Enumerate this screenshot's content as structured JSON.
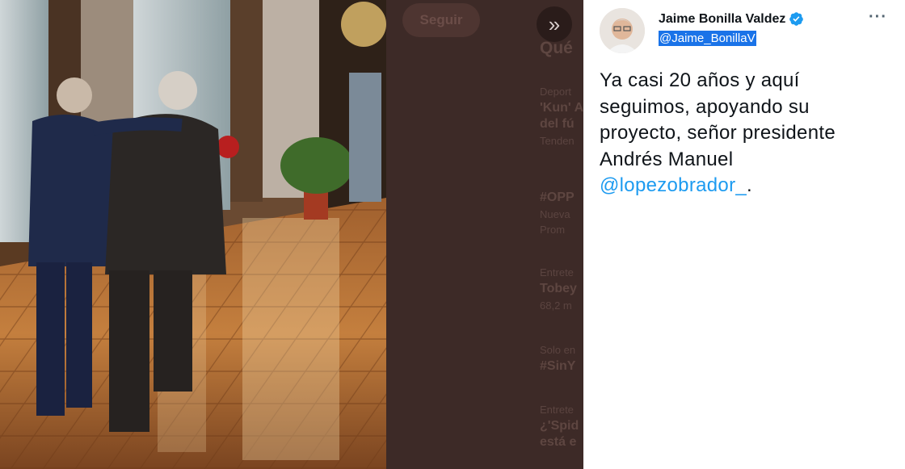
{
  "background": {
    "follow_label": "Seguir",
    "collapse_icon": "double-chevron-right-icon",
    "trends_heading": "Qué",
    "trends": [
      {
        "category": "Deport",
        "title": "'Kun' A",
        "subtitle": "del fú",
        "meta": "Tenden"
      },
      {
        "category": "",
        "title": "#OPP",
        "subtitle": "",
        "meta": "Nueva"
      },
      {
        "category": "",
        "title": "",
        "subtitle": "",
        "meta": "Prom"
      },
      {
        "category": "Entrete",
        "title": "Tobey",
        "subtitle": "",
        "meta": "68,2 m"
      },
      {
        "category": "Solo en",
        "title": "#SinY",
        "subtitle": "",
        "meta": ""
      },
      {
        "category": "Entrete",
        "title": "¿'Spid",
        "subtitle": "está e",
        "meta": ""
      }
    ]
  },
  "tweet": {
    "name": "Jaime Bonilla Valdez",
    "verified_icon": "verified-badge-icon",
    "handle": "@Jaime_BonillaV",
    "more_icon": "more-horizontal-icon",
    "text_before": "Ya casi 20 años y aquí seguimos, apoyando su proyecto, señor presidente Andrés Manuel ",
    "mention": "@lopezobrador_",
    "text_after": ".",
    "accent_color": "#1d9bf0"
  }
}
